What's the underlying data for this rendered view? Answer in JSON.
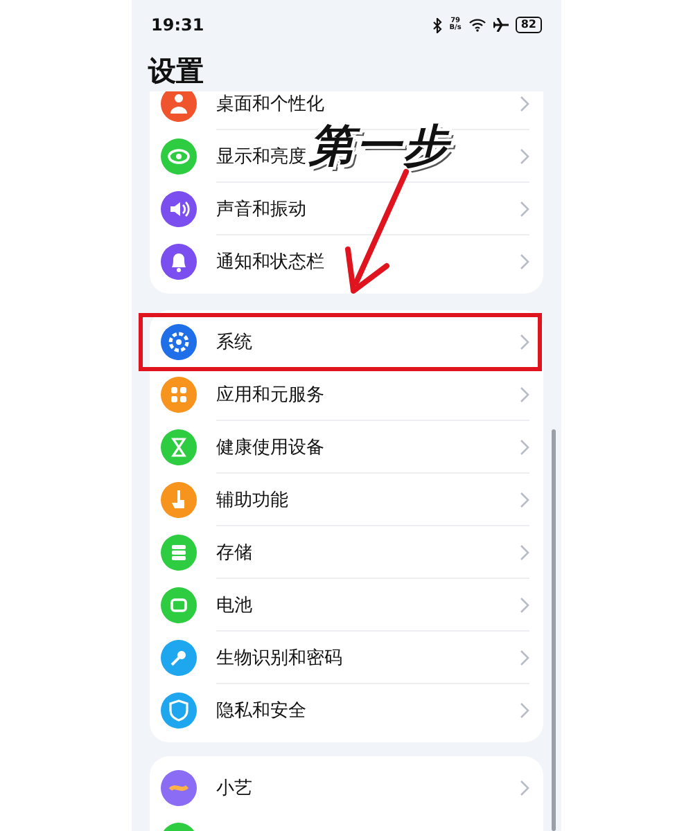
{
  "status_bar": {
    "time": "19:31",
    "speed_value": "79",
    "speed_unit": "B/s",
    "battery": "82"
  },
  "title": "设置",
  "groups": [
    {
      "items": [
        {
          "label": "桌面和个性化",
          "color": "#f0542d",
          "highlighted": false
        },
        {
          "label": "显示和亮度",
          "color": "#2ecc40",
          "highlighted": false
        },
        {
          "label": "声音和振动",
          "color": "#7b4ef0",
          "highlighted": false
        },
        {
          "label": "通知和状态栏",
          "color": "#7b4ef0",
          "highlighted": false
        }
      ]
    },
    {
      "items": [
        {
          "label": "系统",
          "color": "#1f6fe8",
          "highlighted": true
        },
        {
          "label": "应用和元服务",
          "color": "#f7941d",
          "highlighted": false
        },
        {
          "label": "健康使用设备",
          "color": "#2ecc40",
          "highlighted": false
        },
        {
          "label": "辅助功能",
          "color": "#f7941d",
          "highlighted": false
        },
        {
          "label": "存储",
          "color": "#2ecc40",
          "highlighted": false
        },
        {
          "label": "电池",
          "color": "#2ecc40",
          "highlighted": false
        },
        {
          "label": "生物识别和密码",
          "color": "#1ea7ef",
          "highlighted": false
        },
        {
          "label": "隐私和安全",
          "color": "#1ea7ef",
          "highlighted": false
        }
      ]
    },
    {
      "items": [
        {
          "label": "小艺",
          "color": "#8a6cf5",
          "highlighted": false
        }
      ]
    }
  ],
  "annotation": {
    "text": "第一步"
  }
}
